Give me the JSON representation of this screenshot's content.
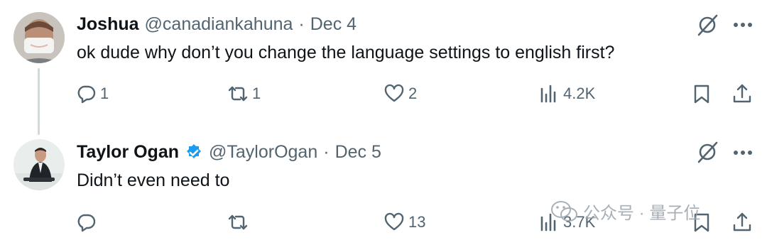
{
  "tweets": [
    {
      "name": "Joshua",
      "handle": "@canadiankahuna",
      "separator": "·",
      "date": "Dec 4",
      "text": "ok dude why don’t you change the language settings to english first?",
      "replies": "1",
      "retweets": "1",
      "likes": "2",
      "views": "4.2K",
      "verified": false
    },
    {
      "name": "Taylor Ogan",
      "handle": "@TaylorOgan",
      "separator": "·",
      "date": "Dec 5",
      "text": "Didn’t even need to",
      "replies": "",
      "retweets": "",
      "likes": "13",
      "views": "3.7K",
      "verified": true
    }
  ],
  "colors": {
    "text": "#0f1419",
    "secondary": "#536471",
    "verified": "#1d9bf0",
    "thread_line": "#cfd9de"
  },
  "icons": [
    "reply-icon",
    "retweet-icon",
    "like-icon",
    "views-icon",
    "bookmark-icon",
    "share-icon",
    "grok-icon",
    "more-icon",
    "verified-badge-icon"
  ],
  "watermark": {
    "text": "公众号 · 量子位"
  }
}
